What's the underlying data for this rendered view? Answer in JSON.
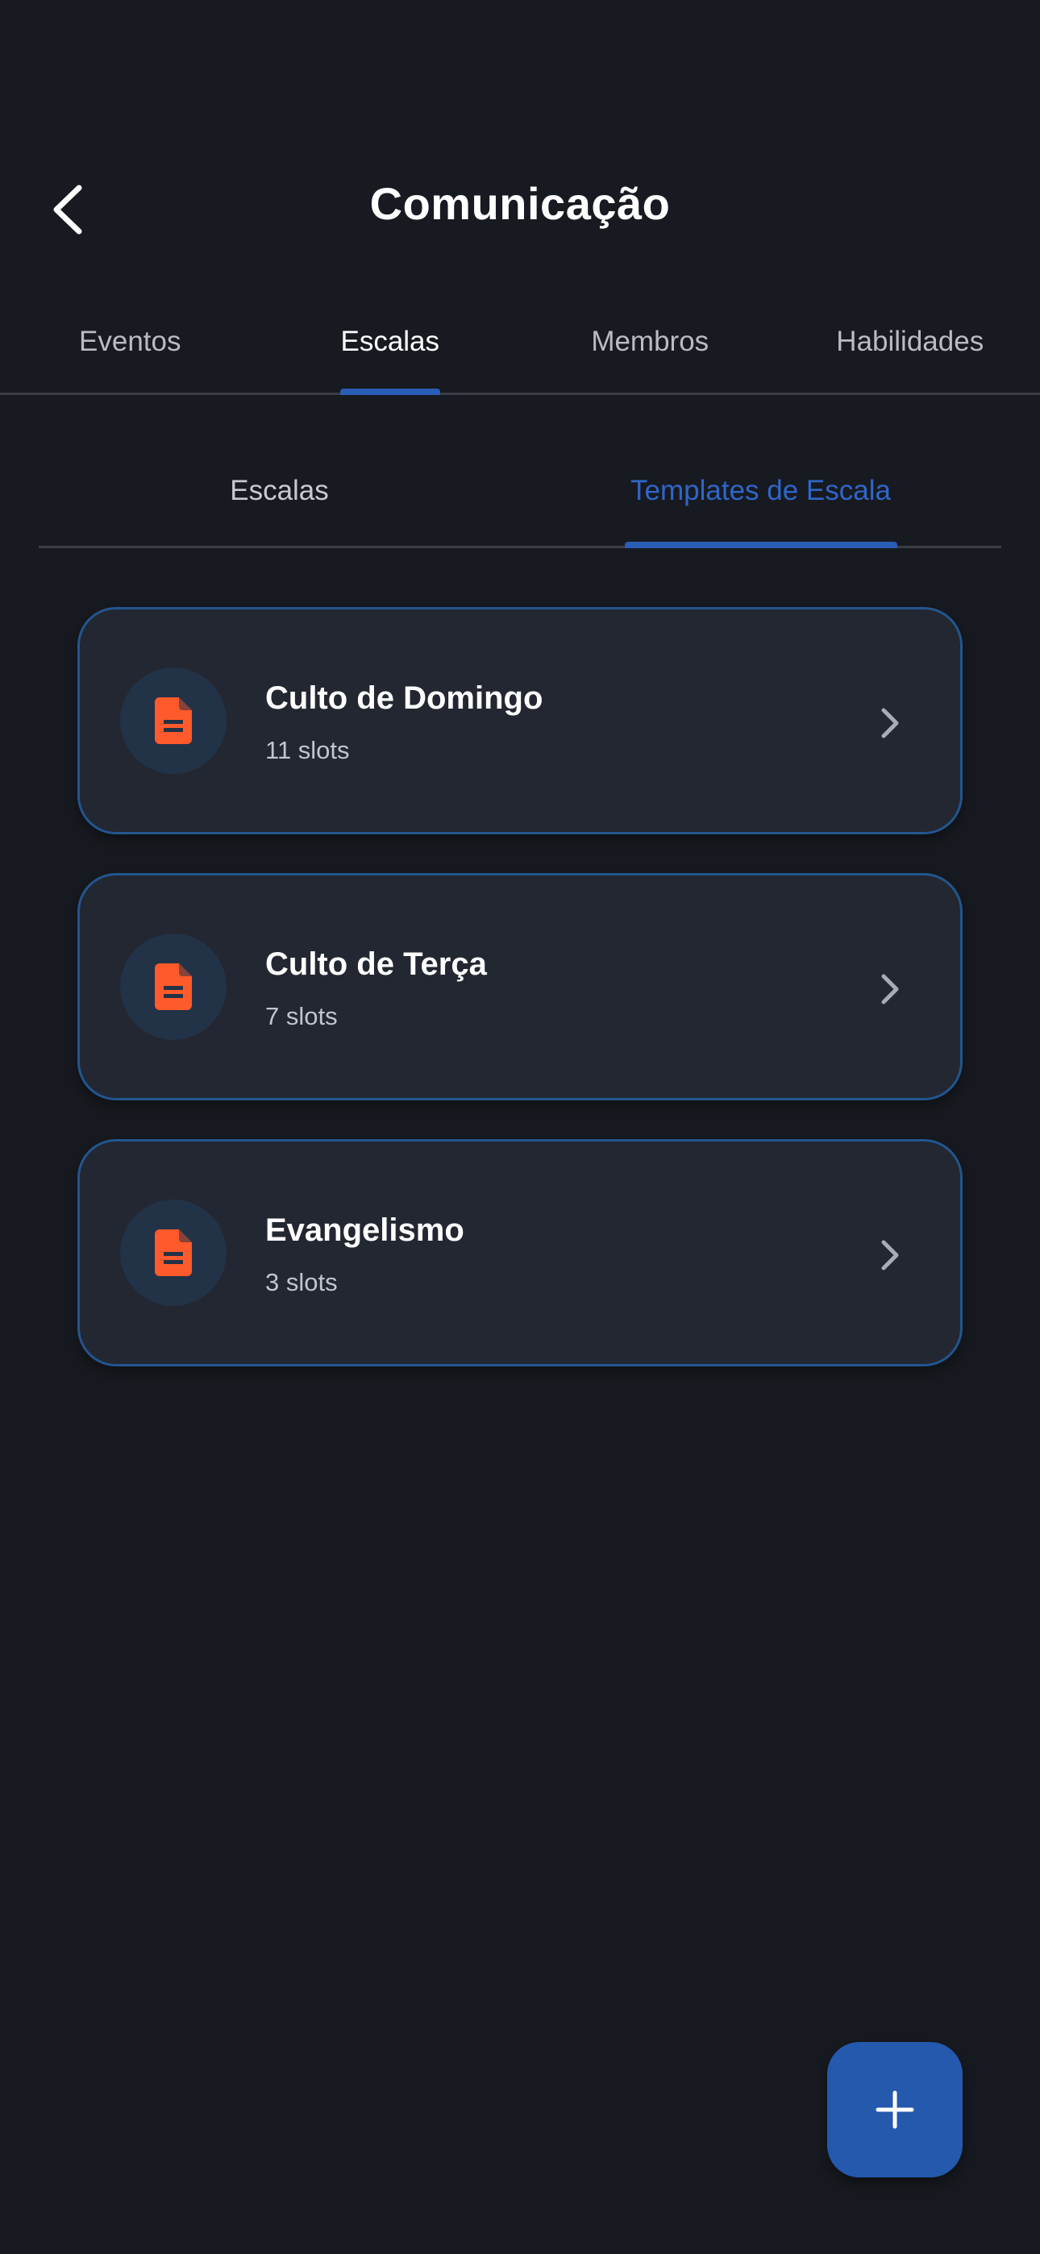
{
  "header": {
    "title": "Comunicação"
  },
  "main_tabs": [
    {
      "label": "Eventos",
      "active": false
    },
    {
      "label": "Escalas",
      "active": true
    },
    {
      "label": "Membros",
      "active": false
    },
    {
      "label": "Habilidades",
      "active": false
    }
  ],
  "sub_tabs": [
    {
      "label": "Escalas",
      "active": false
    },
    {
      "label": "Templates de Escala",
      "active": true
    }
  ],
  "templates": [
    {
      "title": "Culto de Domingo",
      "subtitle": "11 slots",
      "icon": "document-icon"
    },
    {
      "title": "Culto de Terça",
      "subtitle": "7 slots",
      "icon": "document-icon"
    },
    {
      "title": "Evangelismo",
      "subtitle": "3 slots",
      "icon": "document-icon"
    }
  ],
  "colors": {
    "background": "#171a20",
    "accent": "#2a5db5",
    "icon_orange": "#ff5a2b",
    "card_border": "#22568f"
  }
}
